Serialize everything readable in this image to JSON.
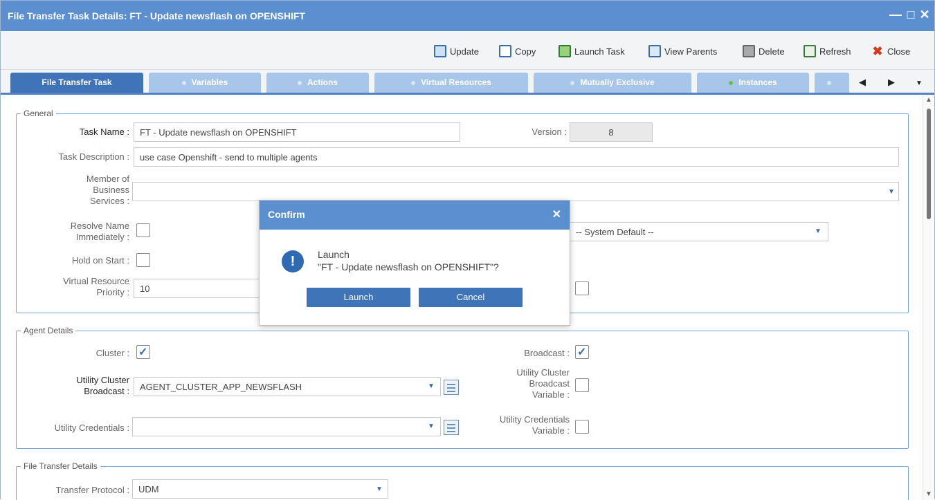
{
  "window": {
    "title": "File Transfer Task Details: FT - Update newsflash on OPENSHIFT",
    "controls": [
      "—",
      "□",
      "✕"
    ]
  },
  "toolbar": {
    "update": "Update",
    "copy": "Copy",
    "launch_task": "Launch Task",
    "view_parents": "View Parents",
    "delete": "Delete",
    "refresh": "Refresh",
    "close": "Close"
  },
  "tabs": [
    {
      "label": "File Transfer Task",
      "active": true
    },
    {
      "label": "Variables"
    },
    {
      "label": "Actions"
    },
    {
      "label": "Virtual Resources"
    },
    {
      "label": "Mutually Exclusive"
    },
    {
      "label": "Instances"
    }
  ],
  "general": {
    "legend": "General",
    "task_name_label": "Task Name :",
    "task_name_value": "FT - Update newsflash on OPENSHIFT",
    "version_label": "Version :",
    "version_value": "8",
    "description_label": "Task Description :",
    "description_value": "use case Openshift - send to multiple agents",
    "member_label_1": "Member of",
    "member_label_2": "Business",
    "member_label_3": "Services :",
    "resolve_label_1": "Resolve Name",
    "resolve_label_2": "Immediately :",
    "hold_label": "Hold on Start :",
    "vr_label_1": "Virtual Resource",
    "vr_label_2": "Priority :",
    "vr_value": "10",
    "system_default": "-- System Default --"
  },
  "agent": {
    "legend": "Agent Details",
    "cluster_label": "Cluster :",
    "broadcast_label": "Broadcast :",
    "ucb_label_1": "Utility Cluster",
    "ucb_label_2": "Broadcast :",
    "ucb_value": "AGENT_CLUSTER_APP_NEWSFLASH",
    "ucbv_label_1": "Utility Cluster",
    "ucbv_label_2": "Broadcast",
    "ucbv_label_3": "Variable :",
    "uc_label": "Utility Credentials :",
    "ucv_label_1": "Utility Credentials",
    "ucv_label_2": "Variable :"
  },
  "file_transfer": {
    "legend": "File Transfer Details",
    "protocol_label": "Transfer Protocol :",
    "protocol_value": "UDM"
  },
  "confirm": {
    "title": "Confirm",
    "line1": "Launch",
    "line2": "\"FT - Update newsflash on OPENSHIFT\"?",
    "launch": "Launch",
    "cancel": "Cancel"
  },
  "colors": {
    "header_blue": "#5b8fcf",
    "tab_active": "#3f74b8",
    "tab_inactive": "#a8c6ea",
    "button_blue": "#3f74b8"
  }
}
